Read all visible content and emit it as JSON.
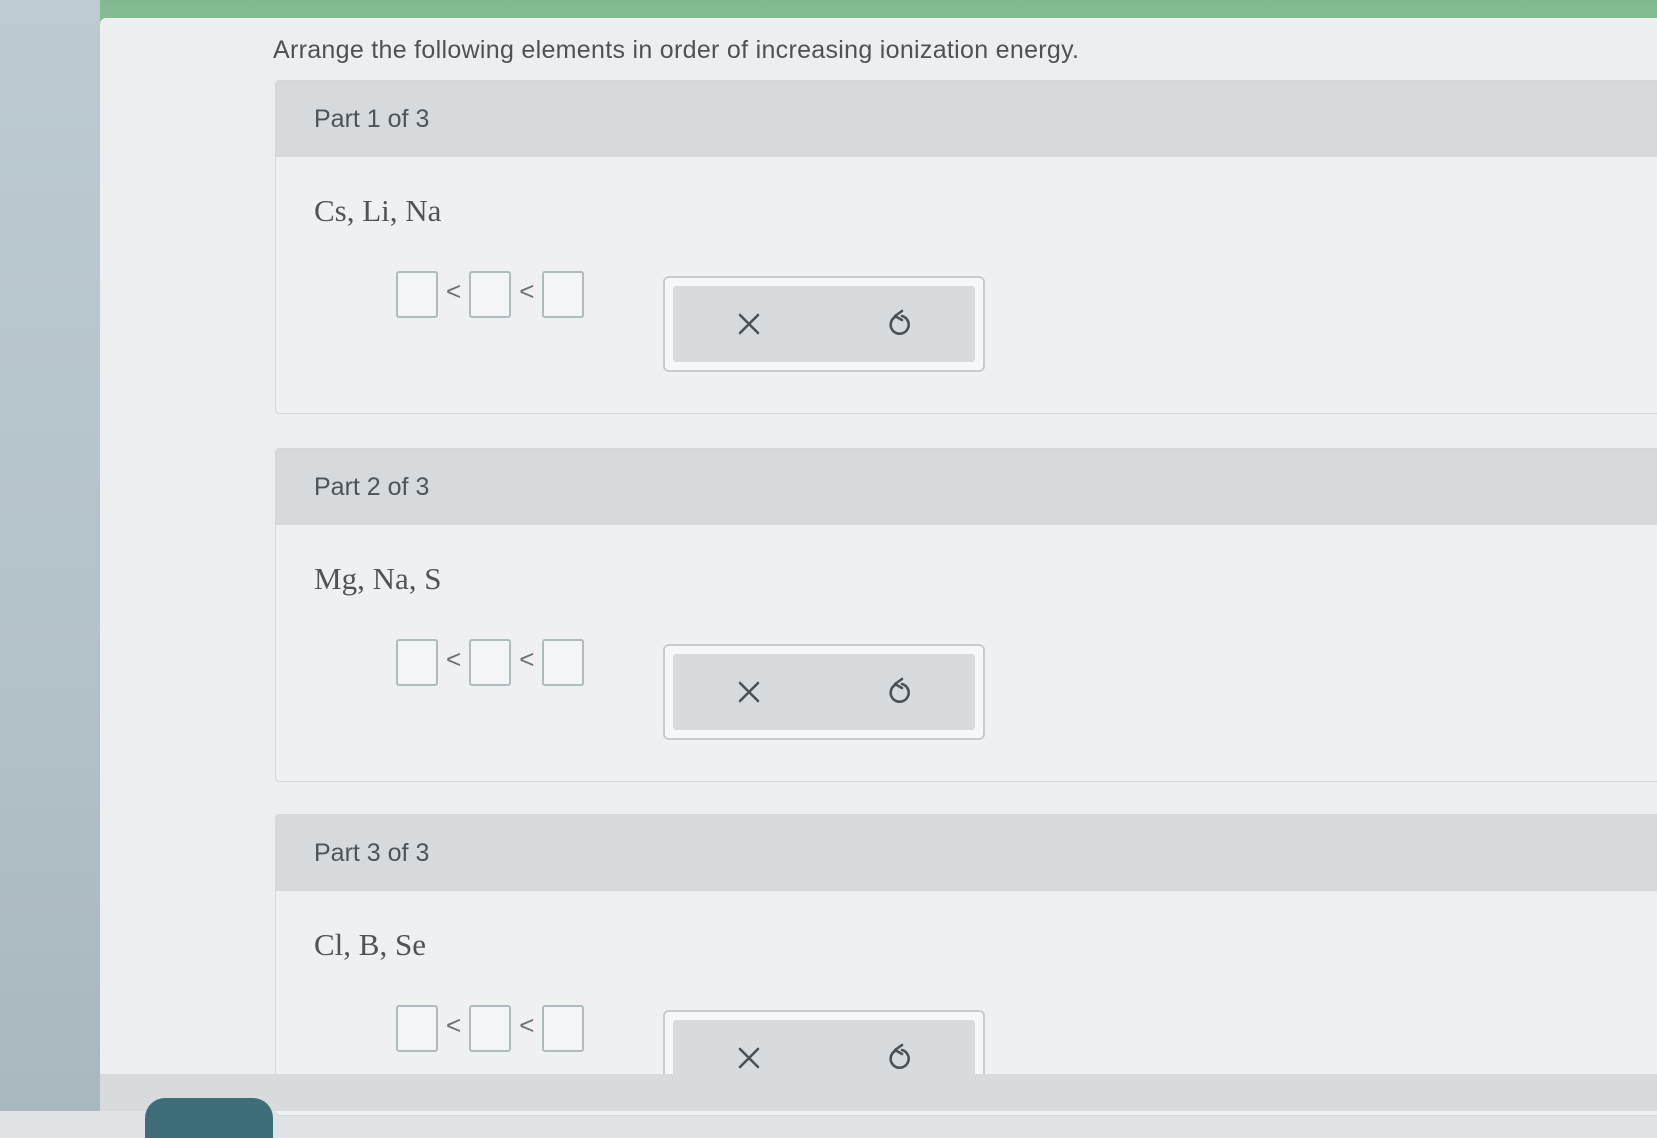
{
  "prompt": "Arrange the following elements in order of increasing ionization energy.",
  "relation_symbol": "<",
  "icons": {
    "clear": "close-icon",
    "reset": "undo-icon"
  },
  "colors": {
    "header_bg": "#d6dadc",
    "box_border": "#aebcc2",
    "top_bar": "#87bf91"
  },
  "parts": [
    {
      "title": "Part 1 of 3",
      "elements": "Cs, Li, Na"
    },
    {
      "title": "Part 2 of 3",
      "elements": "Mg, Na, S"
    },
    {
      "title": "Part 3 of 3",
      "elements": "Cl, B, Se"
    }
  ]
}
